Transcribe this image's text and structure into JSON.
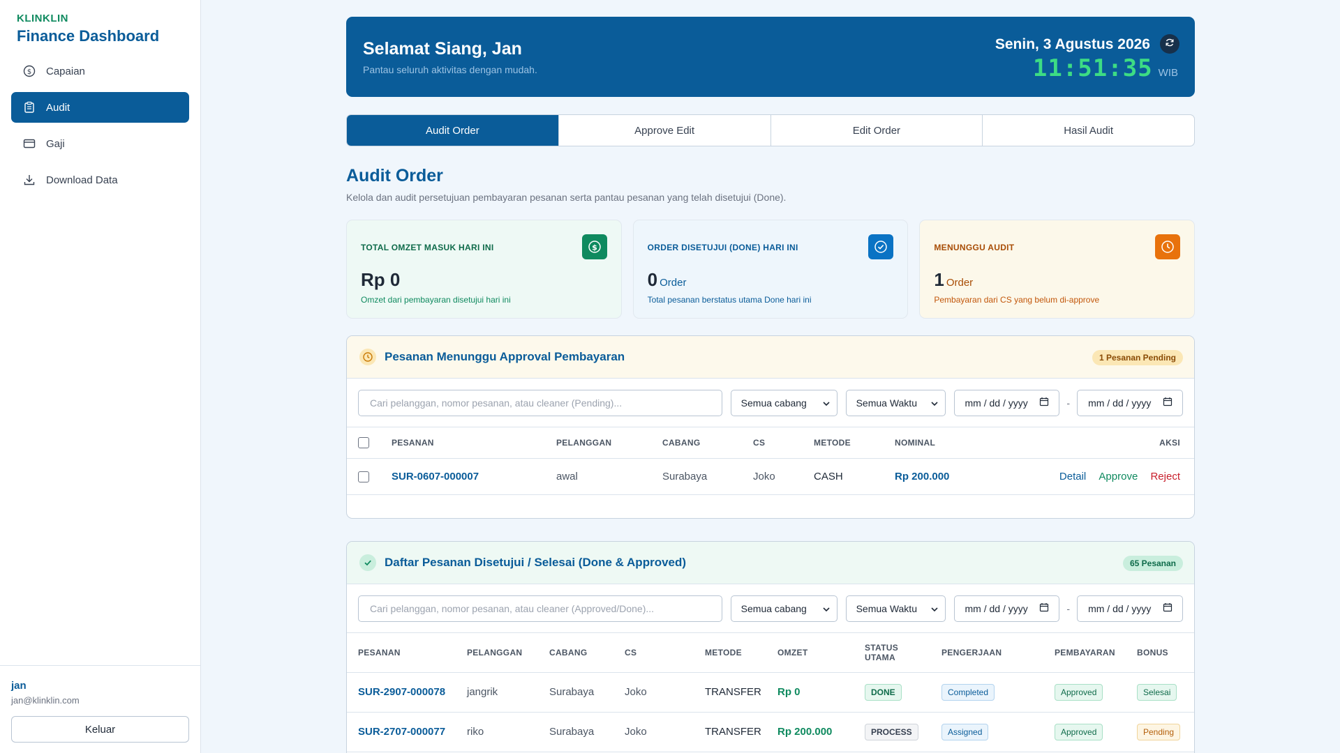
{
  "sidebar": {
    "brand_top": "KLINKLIN",
    "brand_title": "Finance Dashboard",
    "items": [
      {
        "label": "Capaian",
        "icon": "dollar-circle-icon"
      },
      {
        "label": "Audit",
        "icon": "clipboard-icon"
      },
      {
        "label": "Gaji",
        "icon": "credit-card-icon"
      },
      {
        "label": "Download Data",
        "icon": "download-icon"
      }
    ],
    "active_index": 1,
    "user": {
      "name": "jan",
      "email": "jan@klinklin.com"
    },
    "logout_label": "Keluar"
  },
  "header": {
    "greeting": "Selamat Siang, Jan",
    "subtitle": "Pantau seluruh aktivitas dengan mudah.",
    "date": "Senin, 3 Agustus 2026",
    "time": "11:51:35",
    "timezone": "WIB"
  },
  "tabs": [
    {
      "label": "Audit Order"
    },
    {
      "label": "Approve Edit"
    },
    {
      "label": "Edit Order"
    },
    {
      "label": "Hasil Audit"
    }
  ],
  "page": {
    "title": "Audit Order",
    "subtitle": "Kelola dan audit persetujuan pembayaran pesanan serta pantau pesanan yang telah disetujui (Done)."
  },
  "cards": [
    {
      "label": "TOTAL OMZET MASUK HARI INI",
      "value": "Rp 0",
      "unit": "",
      "note": "Omzet dari pembayaran disetujui hari ini",
      "icon": "dollar-icon",
      "color": "#0f8a5f"
    },
    {
      "label": "ORDER DISETUJUI (DONE) HARI INI",
      "value": "0",
      "unit": "Order",
      "note": "Total pesanan berstatus utama Done hari ini",
      "icon": "check-circle-icon",
      "color": "#0a73c4"
    },
    {
      "label": "MENUNGGU AUDIT",
      "value": "1",
      "unit": "Order",
      "note": "Pembayaran dari CS yang belum di-approve",
      "icon": "clock-icon",
      "color": "#e8720c"
    }
  ],
  "pending": {
    "title": "Pesanan Menunggu Approval Pembayaran",
    "badge": "1 Pesanan Pending",
    "search_placeholder": "Cari pelanggan, nomor pesanan, atau cleaner (Pending)...",
    "branch": "Semua cabang",
    "time": "Semua Waktu",
    "date_from": "mm / dd / yyyy",
    "date_to": "mm / dd / yyyy",
    "columns": {
      "order": "PESANAN",
      "customer": "PELANGGAN",
      "branch": "CABANG",
      "cs": "CS",
      "method": "METODE",
      "nominal": "NOMINAL",
      "action": "AKSI"
    },
    "rows": [
      {
        "order": "SUR-0607-000007",
        "customer": "awal",
        "branch": "Surabaya",
        "cs": "Joko",
        "method": "CASH",
        "nominal": "Rp 200.000",
        "detail": "Detail",
        "approve": "Approve",
        "reject": "Reject"
      }
    ]
  },
  "done": {
    "title": "Daftar Pesanan Disetujui / Selesai (Done & Approved)",
    "badge": "65 Pesanan",
    "search_placeholder": "Cari pelanggan, nomor pesanan, atau cleaner (Approved/Done)...",
    "branch": "Semua cabang",
    "time": "Semua Waktu",
    "date_from": "mm / dd / yyyy",
    "date_to": "mm / dd / yyyy",
    "columns": {
      "order": "PESANAN",
      "customer": "PELANGGAN",
      "branch": "CABANG",
      "cs": "CS",
      "method": "METODE",
      "omzet": "OMZET",
      "status1": "STATUS",
      "status2": "UTAMA",
      "work": "PENGERJAAN",
      "payment": "PEMBAYARAN",
      "bonus": "BONUS"
    },
    "rows": [
      {
        "order": "SUR-2907-000078",
        "customer": "jangrik",
        "branch": "Surabaya",
        "cs": "Joko",
        "method": "TRANSFER",
        "omzet": "Rp 0",
        "status": "DONE",
        "work": "Completed",
        "payment": "Approved",
        "bonus": "Selesai"
      },
      {
        "order": "SUR-2707-000077",
        "customer": "riko",
        "branch": "Surabaya",
        "cs": "Joko",
        "method": "TRANSFER",
        "omzet": "Rp 200.000",
        "status": "PROCESS",
        "work": "Assigned",
        "payment": "Approved",
        "bonus": "Pending"
      }
    ]
  }
}
